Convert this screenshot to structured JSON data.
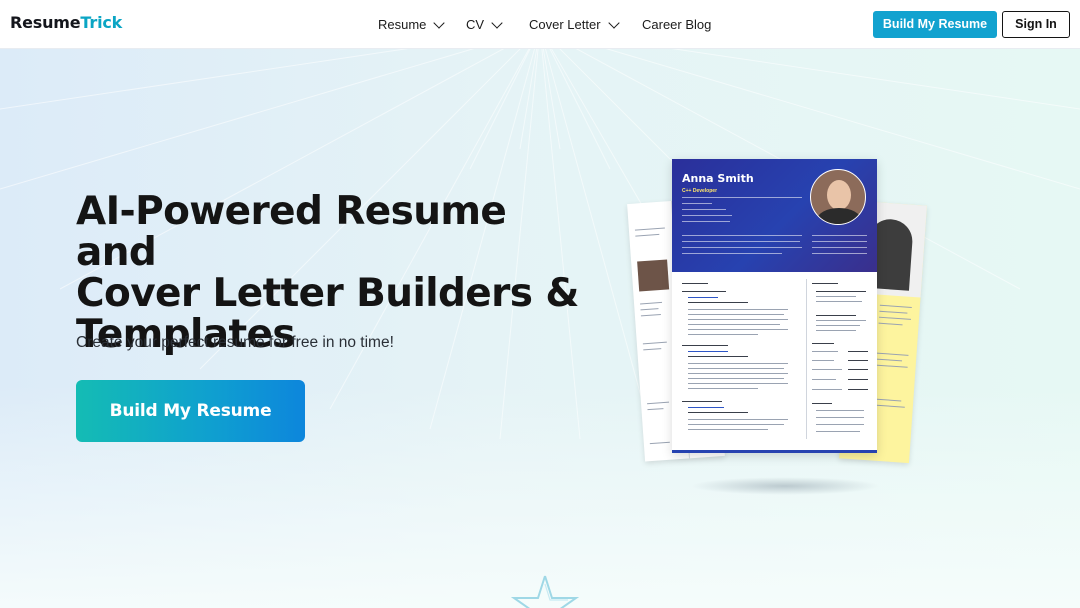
{
  "brand": {
    "part1": "Resume",
    "part2": "Trick",
    "color_dark": "#14161c",
    "color_accent": "#0ba5c4"
  },
  "nav": {
    "items": [
      {
        "label": "Resume",
        "has_dropdown": true
      },
      {
        "label": "CV",
        "has_dropdown": true
      },
      {
        "label": "Cover Letter",
        "has_dropdown": true
      },
      {
        "label": "Career Blog",
        "has_dropdown": false
      }
    ],
    "build_button": "Build My Resume",
    "signin_button": "Sign In"
  },
  "hero": {
    "title_lines": [
      "AI-Powered Resume and",
      "Cover Letter Builders &",
      "Templates"
    ],
    "subtitle": "Create your perfect resume for free in no time!",
    "cta": "Build My Resume"
  },
  "resume_preview": {
    "name": "Anna Smith",
    "role": "C++ Developer"
  },
  "colors": {
    "cta_gradient_start": "#14bcb4",
    "cta_gradient_end": "#0d86dc",
    "nav_button": "#12a2cf",
    "resume_header": "#2742b0",
    "resume_accent_yellow": "#fdf49e"
  }
}
